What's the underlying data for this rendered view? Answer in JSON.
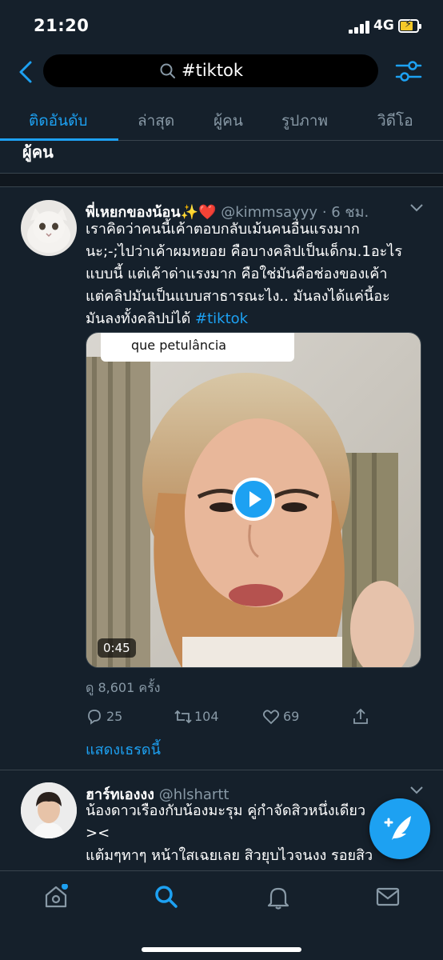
{
  "status_bar": {
    "time": "21:20",
    "network": "4G",
    "battery_charging": true
  },
  "search": {
    "query": "#tiktok"
  },
  "tabs": [
    {
      "label": "ติดอันดับ",
      "active": true
    },
    {
      "label": "ล่าสุด",
      "active": false
    },
    {
      "label": "ผู้คน",
      "active": false
    },
    {
      "label": "รูปภาพ",
      "active": false
    },
    {
      "label": "วิดีโอ",
      "active": false
    }
  ],
  "people_heading": "ผู้คน",
  "tweets": [
    {
      "display_name": "พี่เหยกของน้อน✨❤️",
      "handle": "@kimmsayyy",
      "time": "· 6 ชม.",
      "lines": [
        "เราคิดว่าคนนี้เค้าตอบกลับเม้นคนอื่นแรงมาก",
        "นะ;-;ไปว่าเค้าผมหยอย คือบางคลิปเป็นเด็กม.1อะไร",
        "แบบนี้ แต่เค้าด่าแรงมาก คือใช่มันคือช่องของเค้า",
        "แต่คลิปมันเป็นแบบสาธารณะไง.. มันลงได้แค่นี้อะ"
      ],
      "last_line_text": "มันลงทั้งคลิปบ่ได้ ",
      "hashtag": "#tiktok",
      "video_caption": "que petulância",
      "video_duration": "0:45",
      "views": "ดู 8,601 ครั้ง",
      "replies": "25",
      "retweets": "104",
      "likes": "69",
      "show_thread": "แสดงเธรดนี้"
    },
    {
      "display_name": "ฮาร์ทเองงง",
      "handle": "@hlshartt",
      "lines": [
        "น้องดาวเรืองกับน้องมะรุม คู่กำจัดสิวหนึ่งเดียว",
        "><",
        "แต้มๆทาๆ หน้าใสเฉยเลย สิวยุบไวจนงง รอยสิว"
      ]
    }
  ],
  "colors": {
    "background": "#15202b",
    "accent": "#1da1f2",
    "muted": "#8899a6",
    "divider": "#38444d"
  },
  "icons": [
    "back-arrow-icon",
    "search-icon",
    "filter-sliders-icon",
    "chevron-down-icon",
    "play-icon",
    "reply-icon",
    "retweet-icon",
    "like-icon",
    "share-icon",
    "compose-icon",
    "home-icon",
    "search-icon",
    "notifications-icon",
    "messages-icon"
  ]
}
